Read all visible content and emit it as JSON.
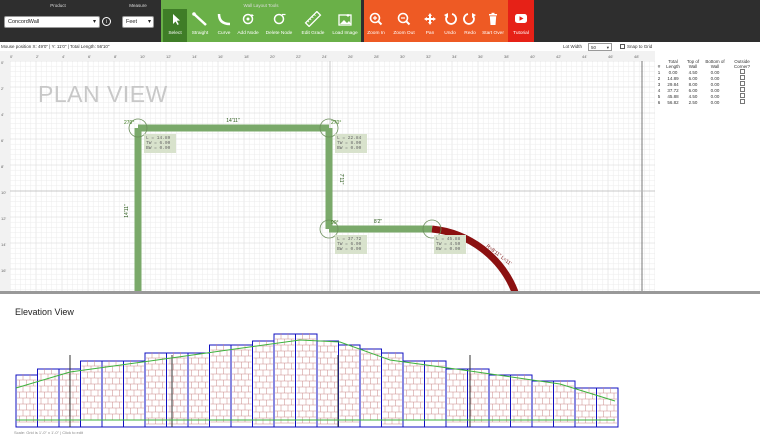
{
  "toolbar": {
    "product": {
      "title": "Product",
      "value": "ConcordWall"
    },
    "measure": {
      "title": "Measure",
      "value": "Feet"
    },
    "wall_tools_title": "Wall Layout Tools",
    "wall_buttons": [
      {
        "label": "Select",
        "icon": "cursor-icon"
      },
      {
        "label": "Straight",
        "icon": "straight-wall-icon"
      },
      {
        "label": "Curve",
        "icon": "curve-wall-icon"
      },
      {
        "label": "Add Node",
        "icon": "add-node-icon"
      },
      {
        "label": "Delete Node",
        "icon": "delete-node-icon"
      },
      {
        "label": "Edit Grade",
        "icon": "ruler-icon"
      },
      {
        "label": "Load Image",
        "icon": "image-icon"
      }
    ],
    "view_buttons": [
      {
        "label": "Zoom In",
        "icon": "zoom-in-icon"
      },
      {
        "label": "Zoom Out",
        "icon": "zoom-out-icon"
      },
      {
        "label": "Pan",
        "icon": "pan-icon"
      },
      {
        "label": "Undo",
        "icon": "undo-icon"
      },
      {
        "label": "Redo",
        "icon": "redo-icon"
      },
      {
        "label": "Start Over",
        "icon": "trash-icon"
      }
    ],
    "tutorial": {
      "label": "Tutorial",
      "icon": "youtube-icon"
    },
    "colors": {
      "wall_tools": "#6ab048",
      "view_tools": "#ee5a24",
      "tutorial": "#e62117"
    }
  },
  "plan_header": {
    "mouse_position": "Mouse position X: 49'0\" | Y: 11'0\" | Total Length: 56'10\"",
    "lot_width_label": "Lot Width",
    "lot_width_value": "50",
    "snap_label": "Snap to Grid",
    "snap_checked": false
  },
  "plan": {
    "title": "PLAN VIEW",
    "ruler_top": [
      "0'",
      "2'",
      "4'",
      "6'",
      "8'",
      "10'",
      "12'",
      "14'",
      "16'",
      "18'",
      "20'",
      "22'",
      "24'",
      "26'",
      "28'",
      "30'",
      "32'",
      "34'",
      "36'",
      "38'",
      "40'",
      "42'",
      "44'",
      "46'",
      "48'",
      "50'"
    ],
    "ruler_left": [
      "0'",
      "2'",
      "4'",
      "6'",
      "8'",
      "10'",
      "12'",
      "14'",
      "16'",
      "18'",
      "20'",
      "22'",
      "24'",
      "26'",
      "28'"
    ],
    "length_labels": {
      "top": "14'11\"",
      "left": "14'11\"",
      "right": "7'11\"",
      "bottom": "8'2\"",
      "arc": "R=8'11\" L=11'"
    },
    "angle_labels": {
      "top_left": "270°",
      "top_right": "270°",
      "bottom_right": "90°"
    },
    "node_infos": [
      {
        "lines": [
          "L = 14.89",
          "TW = 6.00",
          "BW = 0.00"
        ]
      },
      {
        "lines": [
          "L = 22.84",
          "TW = 8.00",
          "BW = 0.00"
        ]
      },
      {
        "lines": [
          "L = 37.72",
          "TW = 6.00",
          "BW = 0.00"
        ]
      },
      {
        "lines": [
          "L = 45.88",
          "TW = 4.50",
          "BW = 0.00"
        ]
      }
    ],
    "colors": {
      "wall": "#7aa96a",
      "arc": "#8b1010"
    }
  },
  "table": {
    "headers": [
      "#",
      "Total Length",
      "Top of Wall",
      "Bottom of Wall",
      "Outside Corner?"
    ],
    "rows": [
      [
        "1",
        "0.00",
        "4.50",
        "0.00"
      ],
      [
        "2",
        "14.89",
        "6.00",
        "0.00"
      ],
      [
        "3",
        "29.84",
        "8.00",
        "0.00"
      ],
      [
        "4",
        "37.72",
        "6.00",
        "0.00"
      ],
      [
        "5",
        "45.88",
        "4.50",
        "0.00"
      ],
      [
        "6",
        "56.82",
        "2.50",
        "0.00"
      ]
    ]
  },
  "elevation": {
    "title": "Elevation View",
    "footer": "Scale: Grid is 1'-0\" x 1'-0\" | Click to edit"
  }
}
